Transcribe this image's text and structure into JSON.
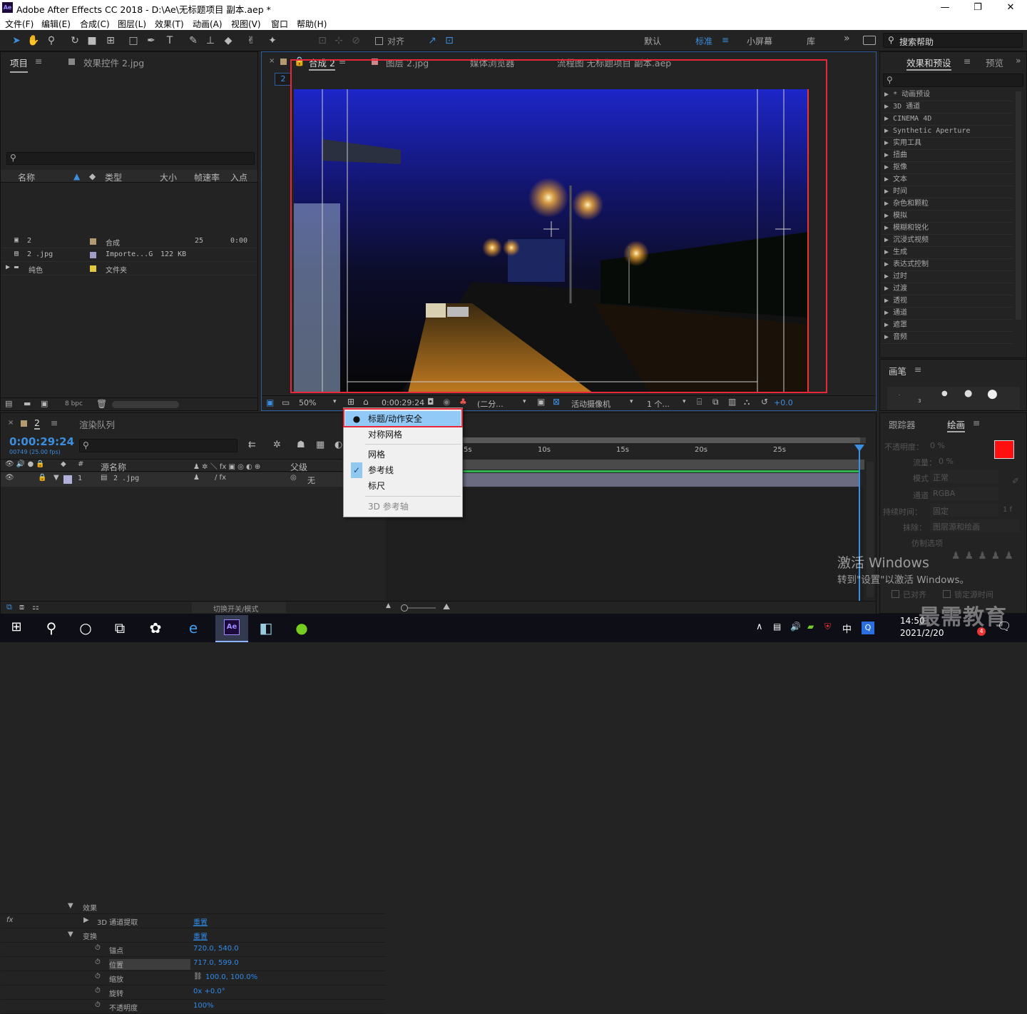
{
  "window": {
    "title": "Adobe After Effects CC 2018 - D:\\Ae\\无标题项目 副本.aep *",
    "logo": "Ae",
    "min": "—",
    "max": "❐",
    "close": "✕"
  },
  "menu": [
    "文件(F)",
    "编辑(E)",
    "合成(C)",
    "图层(L)",
    "效果(T)",
    "动画(A)",
    "视图(V)",
    "窗口",
    "帮助(H)"
  ],
  "toolbar": {
    "align_label": "对齐",
    "workspaces": [
      "默认",
      "标准",
      "小屏幕",
      "库"
    ],
    "active_workspace": "标准",
    "more": "»",
    "search_help": "搜索帮助"
  },
  "project": {
    "tab": "项目",
    "tab2": "效果控件 2.jpg",
    "columns": [
      "名称",
      "类型",
      "大小",
      "帧速率",
      "入点"
    ],
    "rows": [
      {
        "name": "2",
        "type": "合成",
        "size": "",
        "fps": "25",
        "in": "0:00",
        "color": "#b39a70"
      },
      {
        "name": "2 .jpg",
        "type": "Importe...G",
        "size": "122 KB",
        "fps": "",
        "in": "",
        "color": "#9e9ec8"
      },
      {
        "name": "纯色",
        "type": "文件夹",
        "size": "",
        "fps": "",
        "in": "",
        "color": "#e0c840"
      }
    ],
    "bpc": "8 bpc"
  },
  "comp": {
    "tabs": [
      "合成 2",
      "图层 2.jpg",
      "媒体浏览器",
      "流程图 无标题项目 副本.aep"
    ],
    "crumb": "2",
    "zoom": "50%",
    "timecode": "0:00:29:24",
    "resolution": "(二分...",
    "camera": "活动摄像机",
    "views": "1 个...",
    "exposure": "+0.0"
  },
  "context_menu": {
    "items": [
      {
        "label": "标题/动作安全",
        "mark": "●",
        "highlighted": true
      },
      {
        "label": "对称网格",
        "mark": ""
      },
      {
        "label": "网格",
        "mark": "",
        "sep_before": true
      },
      {
        "label": "参考线",
        "mark": "✓"
      },
      {
        "label": "标尺",
        "mark": ""
      },
      {
        "label": "3D 参考轴",
        "mark": "",
        "disabled": true,
        "sep_before": true
      }
    ]
  },
  "effects": {
    "tab": "效果和预设",
    "tab2": "预览",
    "items": [
      "* 动画预设",
      "3D 通道",
      "CINEMA 4D",
      "Synthetic Aperture",
      "实用工具",
      "扭曲",
      "抠像",
      "文本",
      "时间",
      "杂色和颗粒",
      "模拟",
      "模糊和锐化",
      "沉浸式视频",
      "生成",
      "表达式控制",
      "过时",
      "过渡",
      "透视",
      "通道",
      "遮罩",
      "音频"
    ]
  },
  "brush": {
    "tab": "画笔",
    "sizes": [
      "1",
      "3",
      "5",
      "9",
      "13"
    ]
  },
  "paint": {
    "tab1": "跟踪器",
    "tab2": "绘画",
    "opacity_label": "不透明度：",
    "opacity": "0 %",
    "flow_label": "流量：",
    "flow": "0 %",
    "mode_label": "模式：",
    "mode": "正常",
    "channel_label": "通道：",
    "channel": "RGBA",
    "duration_label": "持续时间：",
    "duration": "固定",
    "erase_label": "抹除：",
    "erase": "图层源和绘画",
    "clone_label": "仿制选项",
    "align_label": "已对齐",
    "lock_label": "锁定源时间",
    "page": "1 f"
  },
  "timeline": {
    "tab": "2",
    "tab2": "渲染队列",
    "timecode": "0:00:29:24",
    "frames": "00749 (25.00 fps)",
    "col_name": "源名称",
    "col_parent": "父级",
    "layer": {
      "num": "1",
      "name": "2 .jpg",
      "parent": "无"
    },
    "props": [
      {
        "label": "效果",
        "indent": 1,
        "value": ""
      },
      {
        "label": "3D 通道提取",
        "indent": 2,
        "value": "重置",
        "fx": true
      },
      {
        "label": "变换",
        "indent": 1,
        "value": "重置"
      },
      {
        "label": "锚点",
        "indent": 3,
        "value": "720.0, 540.0"
      },
      {
        "label": "位置",
        "indent": 3,
        "value": "717.0, 599.0"
      },
      {
        "label": "缩放",
        "indent": 3,
        "value": "100.0, 100.0%"
      },
      {
        "label": "旋转",
        "indent": 3,
        "value": "0x +0.0°"
      },
      {
        "label": "不透明度",
        "indent": 3,
        "value": "100%"
      }
    ],
    "ruler": [
      "5s",
      "10s",
      "15s",
      "20s",
      "25s"
    ],
    "toggle": "切换开关/模式"
  },
  "watermark": {
    "line1": "激活 Windows",
    "line2": "转到\"设置\"以激活 Windows。",
    "brand": "最需教育"
  },
  "taskbar": {
    "time": "14:50",
    "date": "2021/2/20",
    "ime": "中",
    "notif": "4"
  }
}
